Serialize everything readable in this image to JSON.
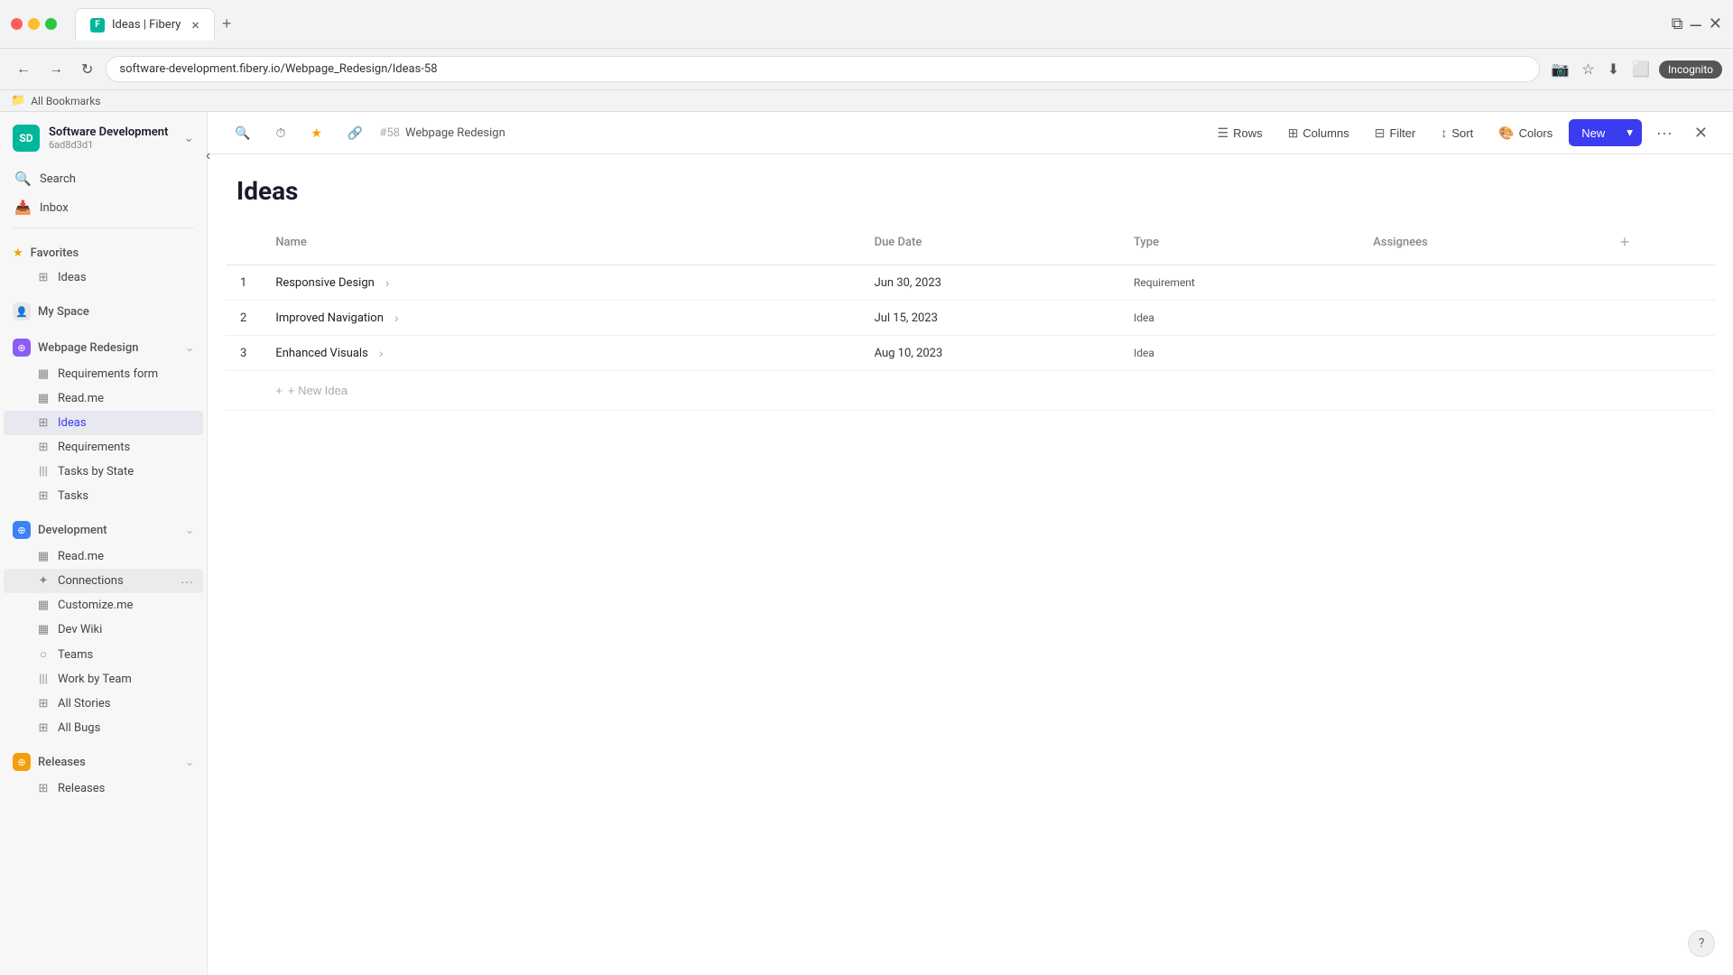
{
  "browser": {
    "tab_title": "Ideas | Fibery",
    "tab_close": "×",
    "new_tab": "+",
    "url": "software-development.fibery.io/Webpage_Redesign/Ideas-58",
    "back": "←",
    "forward": "→",
    "refresh": "↻",
    "incognito": "Incognito",
    "bookmarks_label": "All Bookmarks"
  },
  "workspace": {
    "name": "Software Development",
    "id": "6ad8d3d1",
    "avatar_initials": "SD"
  },
  "sidebar": {
    "search_label": "Search",
    "inbox_label": "Inbox",
    "favorites_label": "Favorites",
    "favorites_items": [
      {
        "label": "Ideas",
        "icon": "⊞"
      }
    ],
    "my_space_label": "My Space",
    "webpage_redesign_label": "Webpage Redesign",
    "webpage_redesign_items": [
      {
        "label": "Requirements form",
        "icon": "▦",
        "active": false
      },
      {
        "label": "Read.me",
        "icon": "▦",
        "active": false
      },
      {
        "label": "Ideas",
        "icon": "⊞",
        "active": true
      },
      {
        "label": "Requirements",
        "icon": "⊞",
        "active": false
      },
      {
        "label": "Tasks by State",
        "icon": "|||",
        "active": false
      },
      {
        "label": "Tasks",
        "icon": "⊞",
        "active": false
      }
    ],
    "development_label": "Development",
    "development_items": [
      {
        "label": "Read.me",
        "icon": "▦"
      },
      {
        "label": "Connections",
        "icon": "✦",
        "hovered": true
      },
      {
        "label": "Customize.me",
        "icon": "▦"
      },
      {
        "label": "Dev Wiki",
        "icon": "▦"
      },
      {
        "label": "Teams",
        "icon": "○"
      },
      {
        "label": "Work by Team",
        "icon": "|||"
      },
      {
        "label": "All Stories",
        "icon": "⊞"
      },
      {
        "label": "All Bugs",
        "icon": "⊞"
      }
    ],
    "releases_label": "Releases",
    "releases_items": [
      {
        "label": "Releases",
        "icon": "⊞"
      }
    ]
  },
  "toolbar": {
    "rows_label": "Rows",
    "columns_label": "Columns",
    "filter_label": "Filter",
    "sort_label": "Sort",
    "colors_label": "Colors",
    "new_label": "New",
    "breadcrumb_id": "#58",
    "breadcrumb_name": "Webpage Redesign",
    "more_dots": "···",
    "close": "×"
  },
  "content": {
    "title": "Ideas",
    "table": {
      "columns": [
        "Name",
        "Due Date",
        "Type",
        "Assignees"
      ],
      "rows": [
        {
          "num": "1",
          "name": "Responsive Design",
          "due_date": "Jun 30, 2023",
          "type": "Requirement",
          "assignees": ""
        },
        {
          "num": "2",
          "name": "Improved Navigation",
          "due_date": "Jul 15, 2023",
          "type": "Idea",
          "assignees": ""
        },
        {
          "num": "3",
          "name": "Enhanced Visuals",
          "due_date": "Aug 10, 2023",
          "type": "Idea",
          "assignees": ""
        }
      ],
      "new_idea_label": "+ New Idea"
    }
  }
}
